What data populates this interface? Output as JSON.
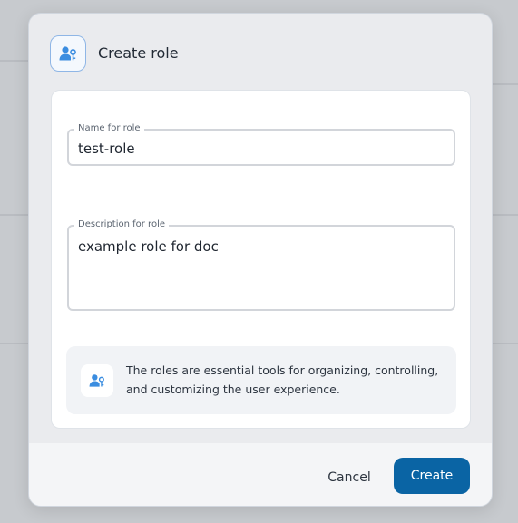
{
  "modal": {
    "title": "Create role",
    "header_icon": "user-key-icon"
  },
  "form": {
    "name_label": "Name for role",
    "name_value": "test-role",
    "description_label": "Description for role",
    "description_value": "example role for doc"
  },
  "info": {
    "icon": "user-key-icon",
    "text": "The roles are essential tools for organizing, controlling, and customizing the user experience."
  },
  "footer": {
    "cancel_label": "Cancel",
    "create_label": "Create"
  },
  "colors": {
    "accent": "#0a64a4",
    "icon_blue": "#3b8de0"
  }
}
